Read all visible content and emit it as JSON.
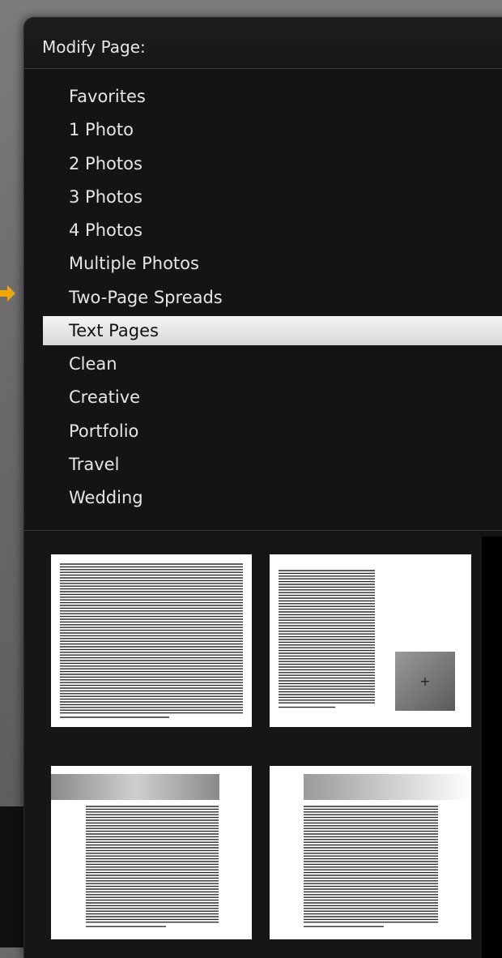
{
  "panel": {
    "title": "Modify Page:"
  },
  "menu": {
    "items": [
      {
        "label": "Favorites"
      },
      {
        "label": "1 Photo"
      },
      {
        "label": "2 Photos"
      },
      {
        "label": "3 Photos"
      },
      {
        "label": "4 Photos"
      },
      {
        "label": "Multiple Photos"
      },
      {
        "label": "Two-Page Spreads"
      },
      {
        "label": "Text Pages",
        "selected": true
      },
      {
        "label": "Clean"
      },
      {
        "label": "Creative"
      },
      {
        "label": "Portfolio"
      },
      {
        "label": "Travel"
      },
      {
        "label": "Wedding"
      }
    ]
  },
  "thumbnails": {
    "photo_cell_symbol": "+"
  },
  "colors": {
    "panel_bg": "#141414",
    "selection_bg": "#e6e6e6",
    "indicator_arrow": "#f0a800"
  }
}
